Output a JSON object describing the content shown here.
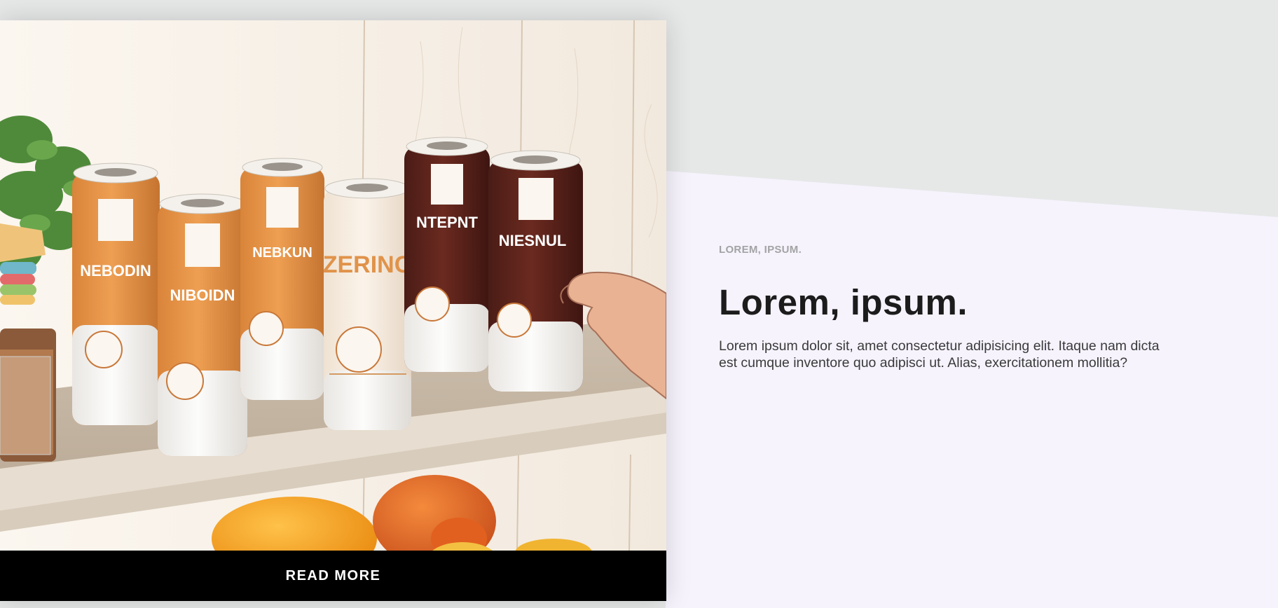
{
  "hero": {
    "can_labels": [
      "NEBODIN",
      "NIBOIDN",
      "NEBKUN",
      "ZERINC",
      "NTEPNT",
      "NIESNUL"
    ]
  },
  "card": {
    "cta_label": "READ MORE"
  },
  "content": {
    "eyebrow": "LOREM, IPSUM.",
    "title": "Lorem, ipsum.",
    "body": "Lorem ipsum dolor sit, amet consectetur adipisicing elit. Itaque nam dicta est cumque inventore quo adipisci ut. Alias, exercitationem mollitia?"
  },
  "colors": {
    "background": "#e6e8e8",
    "panel": "#f6f3fd",
    "button": "#000000",
    "eyebrow": "#a3a3a3",
    "title": "#1c1c1c"
  }
}
